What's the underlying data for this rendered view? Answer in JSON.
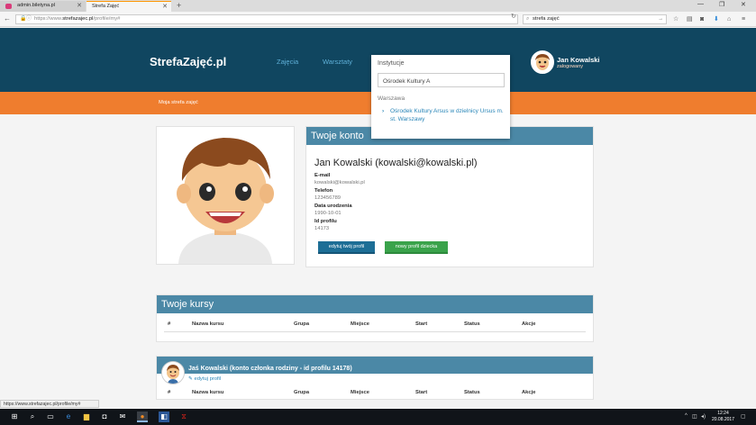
{
  "browser": {
    "tabs": [
      {
        "title": "admin.biletyna.pl",
        "active": false
      },
      {
        "title": "Strefa Zajęć",
        "active": true
      }
    ],
    "url_prefix": "https://www.",
    "url_domain": "strefazajec.pl",
    "url_path": "/profile/my#",
    "search_value": "strefa zajęć",
    "status_url": "https://www.strefazajec.pl/profile/my#"
  },
  "site": {
    "logo": "StrefaZajęć.pl",
    "nav": [
      "Zajęcia",
      "Warsztaty"
    ],
    "user_name": "Jan Kowalski",
    "user_status": "zalogowany",
    "breadcrumb": "Moja strefa zajęć"
  },
  "dropdown": {
    "label": "Instytucje",
    "input_value": "Ośrodek Kultury A",
    "city": "Warszawa",
    "result": "Ośrodek Kultury Arsus w dzielnicy Ursus m. st. Warszawy"
  },
  "account": {
    "heading": "Twoje konto",
    "full_name": "Jan Kowalski (kowalski@kowalski.pl)",
    "fields": [
      {
        "label": "E-mail",
        "value": "kowalski@kowalski.pl"
      },
      {
        "label": "Telefon",
        "value": "123456789"
      },
      {
        "label": "Data urodzenia",
        "value": "1990-10-01"
      },
      {
        "label": "Id profilu",
        "value": "14173"
      }
    ],
    "edit_button": "edytuj twój profil",
    "new_child_button": "nowy profil dziecka"
  },
  "courses": {
    "heading": "Twoje kursy",
    "columns": [
      "#",
      "Nazwa kursu",
      "Grupa",
      "Miejsce",
      "Start",
      "Status",
      "Akcje"
    ]
  },
  "family": {
    "title": "Jaś Kowalski (konto członka rodziny - id profilu 14178)",
    "edit_link": "edytuj profil",
    "columns": [
      "#",
      "Nazwa kursu",
      "Grupa",
      "Miejsce",
      "Start",
      "Status",
      "Akcje"
    ]
  },
  "taskbar": {
    "time": "12:24",
    "date": "20.08.2017"
  },
  "colors": {
    "header": "#104660",
    "accent_orange": "#ef7d2e",
    "panel_blue": "#4b88a6",
    "button_blue": "#1d6e96",
    "button_green": "#3aa34b"
  }
}
